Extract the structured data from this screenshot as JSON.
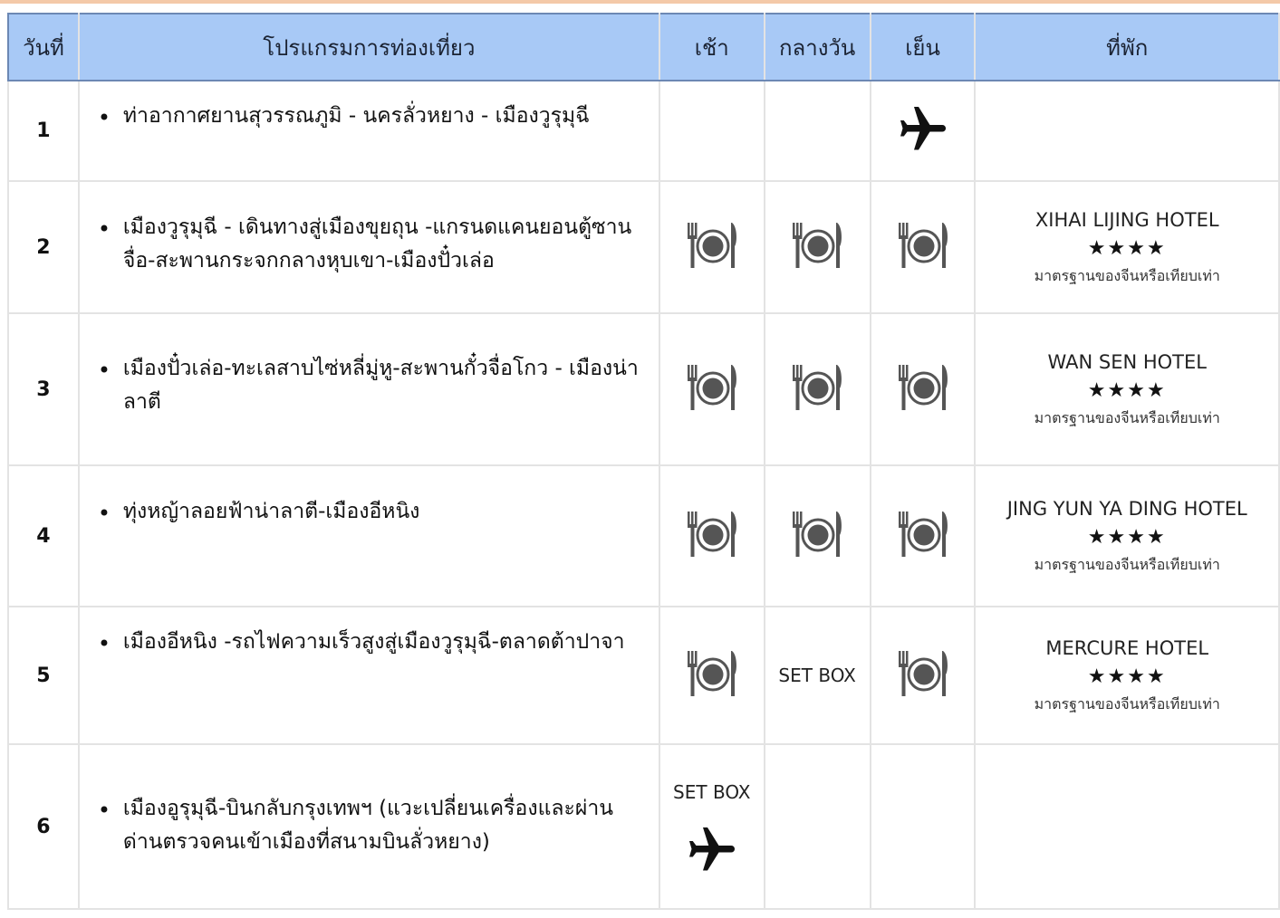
{
  "header": {
    "day": "วันที่",
    "program": "โปรแกรมการท่องเที่ยว",
    "breakfast": "เช้า",
    "lunch": "กลางวัน",
    "dinner": "เย็น",
    "hotel": "ที่พัก"
  },
  "rows": [
    {
      "day": "1",
      "program": "ท่าอากาศยานสุวรรณภูมิ - นครลั่วหยาง - เมืองวูรุมุฉี",
      "breakfast": "",
      "lunch": "",
      "dinner": "plane-icon",
      "hotel_name": "",
      "hotel_stars": "",
      "hotel_standard": ""
    },
    {
      "day": "2",
      "program": "เมืองวูรุมุฉี - เดินทางสู่เมืองขุยถุน -แกรนดแคนยอนตู้ซานจื่อ-สะพานกระจกกลางหุบเขา-เมืองปั๋วเล่อ",
      "breakfast": "meal-icon",
      "lunch": "meal-icon",
      "dinner": "meal-icon",
      "hotel_name": "XIHAI LIJING HOTEL",
      "hotel_stars": "★★★★",
      "hotel_standard": "มาตรฐานของจีนหรือเทียบเท่า"
    },
    {
      "day": "3",
      "program": "เมืองปั๋วเล่อ-ทะเลสาบไซ่หลี่มู่หู-สะพานกั๋วจื่อโกว - เมืองน่าลาตี",
      "breakfast": "meal-icon",
      "lunch": "meal-icon",
      "dinner": "meal-icon",
      "hotel_name": "WAN SEN HOTEL",
      "hotel_stars": "★★★★",
      "hotel_standard": "มาตรฐานของจีนหรือเทียบเท่า"
    },
    {
      "day": "4",
      "program": "ทุ่งหญ้าลอยฟ้าน่าลาตี-เมืองอีหนิง",
      "breakfast": "meal-icon",
      "lunch": "meal-icon",
      "dinner": "meal-icon",
      "hotel_name": "JING YUN YA DING HOTEL",
      "hotel_stars": "★★★★",
      "hotel_standard": "มาตรฐานของจีนหรือเทียบเท่า"
    },
    {
      "day": "5",
      "program": "เมืองอีหนิง -รถไฟความเร็วสูงสู่เมืองวูรุมุฉี-ตลาดต้าปาจา",
      "breakfast": "meal-icon",
      "lunch": "SET BOX",
      "dinner": "meal-icon",
      "hotel_name": "MERCURE HOTEL",
      "hotel_stars": "★★★★",
      "hotel_standard": "มาตรฐานของจีนหรือเทียบเท่า"
    },
    {
      "day": "6",
      "program": "เมืองอูรุมุฉี-บินกลับกรุงเทพฯ (แวะเปลี่ยนเครื่องและผ่านด่านตรวจคนเข้าเมืองที่สนามบินลั่วหยาง)",
      "breakfast": "SET BOX",
      "lunch": "",
      "dinner": "",
      "hotel_name": "",
      "hotel_stars": "",
      "hotel_standard": ""
    }
  ],
  "colors": {
    "header_bg": "#a8c9f6",
    "header_border": "#6c88b4",
    "meal_icon": "#555555"
  }
}
